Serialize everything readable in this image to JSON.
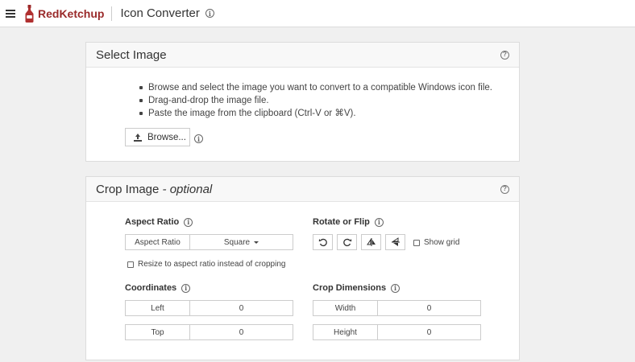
{
  "header": {
    "brand": "RedKetchup",
    "app_title": "Icon Converter",
    "info_icon": "info-icon",
    "menu_icon": "hamburger-menu-icon"
  },
  "select_image": {
    "title": "Select Image",
    "help_icon": "help-icon",
    "bullets": [
      "Browse and select the image you want to convert to a compatible Windows icon file.",
      "Drag-and-drop the image file.",
      "Paste the image from the clipboard (Ctrl-V or ⌘V)."
    ],
    "browse_label": "Browse..."
  },
  "crop_image": {
    "title": "Crop Image",
    "title_suffix": " - optional",
    "help_icon": "help-icon",
    "aspect_ratio": {
      "label": "Aspect Ratio",
      "field_label": "Aspect Ratio",
      "value": "Square",
      "resize_checkbox_label": "Resize to aspect ratio instead of cropping",
      "resize_checked": false
    },
    "rotate_flip": {
      "label": "Rotate or Flip",
      "show_grid_label": "Show grid",
      "show_grid_checked": false
    },
    "coordinates": {
      "label": "Coordinates",
      "left_label": "Left",
      "left_value": "0",
      "top_label": "Top",
      "top_value": "0"
    },
    "crop_dimensions": {
      "label": "Crop Dimensions",
      "width_label": "Width",
      "width_value": "0",
      "height_label": "Height",
      "height_value": "0"
    }
  },
  "colors": {
    "brand": "#9a2a2a",
    "background": "#f0f0f0"
  }
}
